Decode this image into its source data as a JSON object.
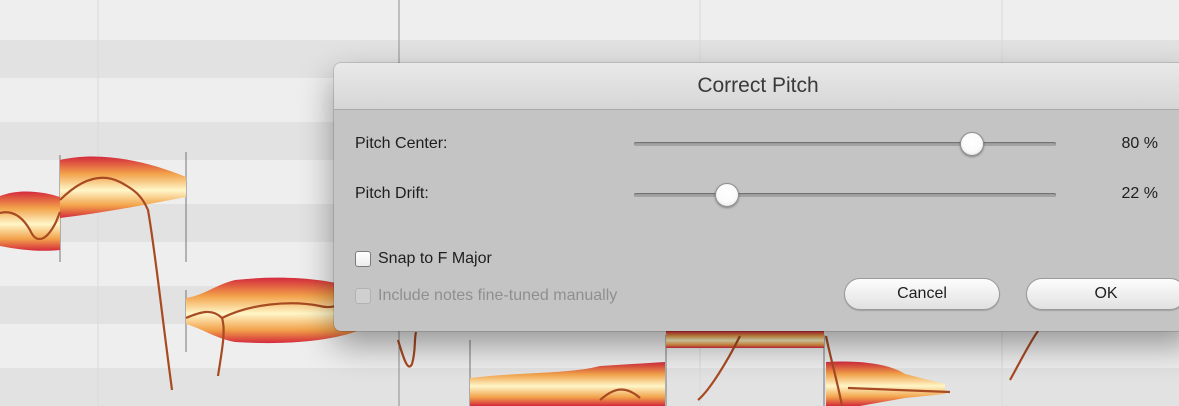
{
  "dialog": {
    "title": "Correct Pitch",
    "pitch_center": {
      "label": "Pitch Center:",
      "percent": 80,
      "value_text": "80 %"
    },
    "pitch_drift": {
      "label": "Pitch Drift:",
      "percent": 22,
      "value_text": "22 %"
    },
    "snap_checkbox": {
      "label": "Snap to F Major",
      "checked": false,
      "enabled": true
    },
    "include_checkbox": {
      "label": "Include notes fine-tuned manually",
      "checked": false,
      "enabled": false
    },
    "cancel_label": "Cancel",
    "ok_label": "OK"
  },
  "colors": {
    "background": "#ebebeb",
    "blob_outer": "#d42a3c",
    "blob_mid": "#f2a24a",
    "blob_inner": "#fff6c8",
    "pitch_curve": "#a84a22",
    "dialog": "#c4c4c4"
  }
}
